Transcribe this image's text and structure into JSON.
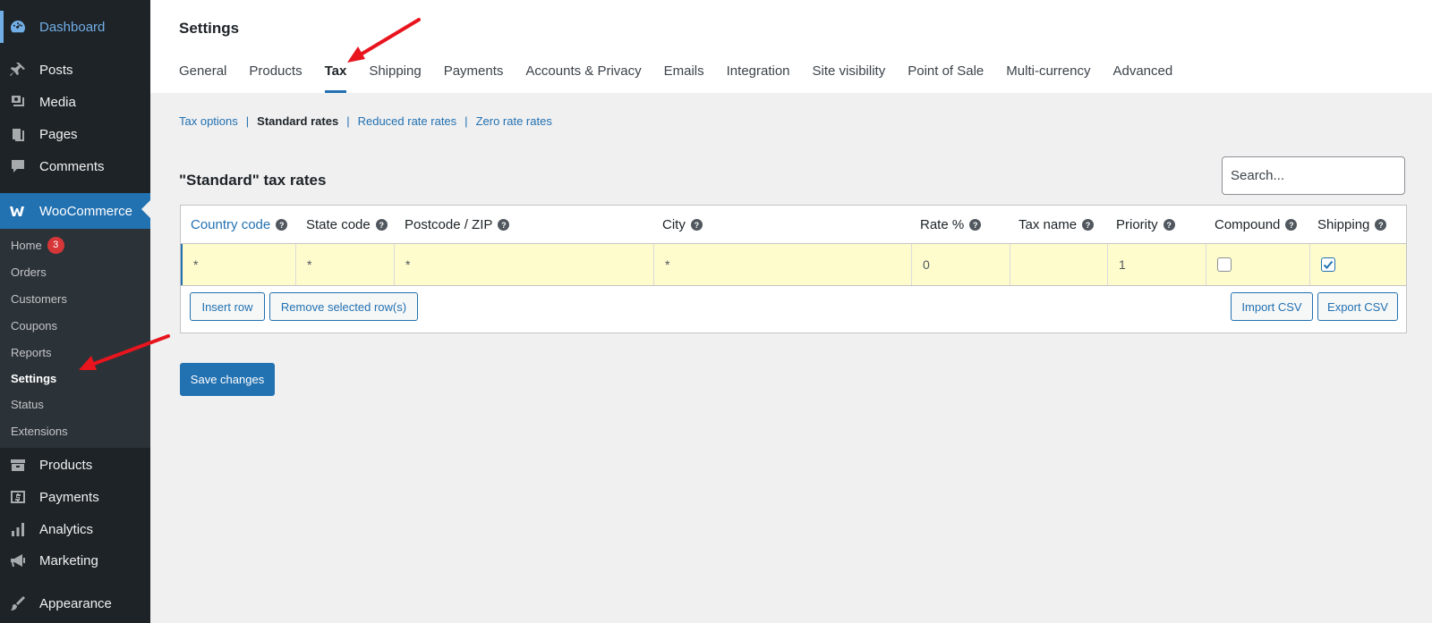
{
  "sidebar": {
    "top_items": [
      {
        "label": "Dashboard",
        "icon": "dashboard-icon"
      },
      {
        "label": "Posts",
        "icon": "pin-icon"
      },
      {
        "label": "Media",
        "icon": "media-icon"
      },
      {
        "label": "Pages",
        "icon": "pages-icon"
      },
      {
        "label": "Comments",
        "icon": "comment-icon"
      },
      {
        "label": "WooCommerce",
        "icon": "woocommerce-icon"
      }
    ],
    "woo_submenu": [
      {
        "label": "Home",
        "badge": "3"
      },
      {
        "label": "Orders"
      },
      {
        "label": "Customers"
      },
      {
        "label": "Coupons"
      },
      {
        "label": "Reports"
      },
      {
        "label": "Settings"
      },
      {
        "label": "Status"
      },
      {
        "label": "Extensions"
      }
    ],
    "bottom_items": [
      {
        "label": "Products",
        "icon": "archive-icon"
      },
      {
        "label": "Payments",
        "icon": "dollar-icon"
      },
      {
        "label": "Analytics",
        "icon": "bar-chart-icon"
      },
      {
        "label": "Marketing",
        "icon": "megaphone-icon"
      },
      {
        "label": "Appearance",
        "icon": "paintbrush-icon"
      }
    ]
  },
  "header": {
    "title": "Settings",
    "tabs": [
      "General",
      "Products",
      "Tax",
      "Shipping",
      "Payments",
      "Accounts & Privacy",
      "Emails",
      "Integration",
      "Site visibility",
      "Point of Sale",
      "Multi-currency",
      "Advanced"
    ],
    "active_tab": "Tax"
  },
  "subnav": {
    "items": [
      "Tax options",
      "Standard rates",
      "Reduced rate rates",
      "Zero rate rates"
    ],
    "separator": "|",
    "active": "Standard rates"
  },
  "section": {
    "title": "\"Standard\" tax rates",
    "search_placeholder": "Search..."
  },
  "table": {
    "headers": [
      "Country code",
      "State code",
      "Postcode / ZIP",
      "City",
      "Rate %",
      "Tax name",
      "Priority",
      "Compound",
      "Shipping"
    ],
    "help_glyph": "?",
    "row": {
      "country": "*",
      "state": "*",
      "postcode": "*",
      "city": "*",
      "rate": "0",
      "tax_name": "",
      "priority": "1",
      "compound": false,
      "shipping": true
    }
  },
  "buttons": {
    "insert_row": "Insert row",
    "remove_rows": "Remove selected row(s)",
    "import_csv": "Import CSV",
    "export_csv": "Export CSV",
    "save": "Save changes"
  },
  "colors": {
    "sidebar_bg": "#1d2327",
    "accent": "#2271b1",
    "row_highlight": "#fefbcc",
    "annotation_arrow": "#e8141e"
  }
}
